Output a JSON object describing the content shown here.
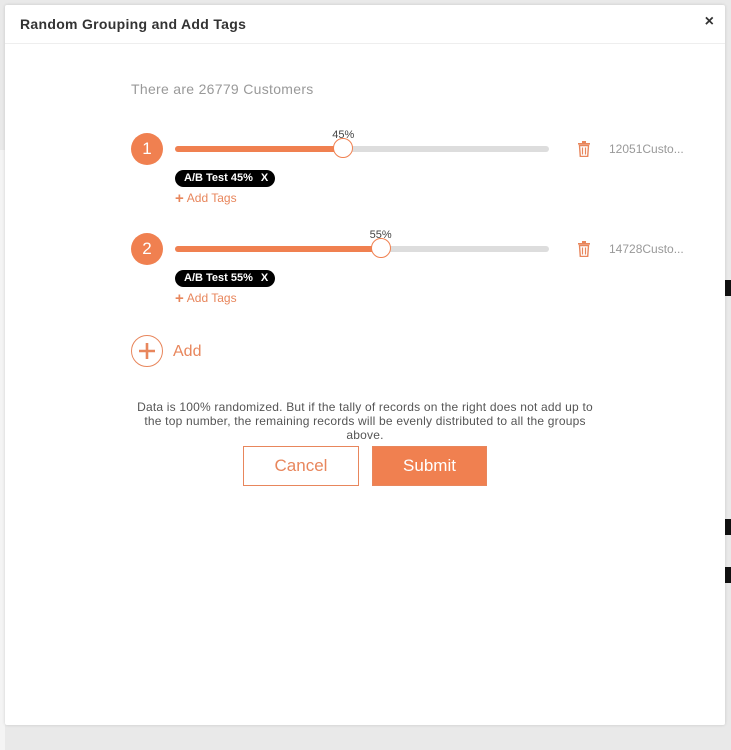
{
  "modal": {
    "title": "Random Grouping and Add Tags",
    "close_label": "×"
  },
  "summary": {
    "customers_text": "There are 26779 Customers"
  },
  "groups": [
    {
      "number": "1",
      "percent": 45,
      "percent_label": "45%",
      "count_label": "12051Custo...",
      "tag_label": "A/B Test 45%",
      "tag_remove": "X",
      "add_tags_label": "Add Tags"
    },
    {
      "number": "2",
      "percent": 55,
      "percent_label": "55%",
      "count_label": "14728Custo...",
      "tag_label": "A/B Test 55%",
      "tag_remove": "X",
      "add_tags_label": "Add Tags"
    }
  ],
  "add_group": {
    "label": "Add"
  },
  "note": "Data is 100% randomized. But if the tally of records on the right does not add up to the top number, the remaining records will be evenly distributed to all the groups above.",
  "buttons": {
    "cancel": "Cancel",
    "submit": "Submit"
  },
  "icons": {
    "close": "close-icon",
    "delete": "trash-icon",
    "add": "plus-circle-icon",
    "add_tag": "plus-icon"
  },
  "colors": {
    "accent": "#f08050",
    "track": "#dddddd",
    "tag_bg": "#000000"
  }
}
